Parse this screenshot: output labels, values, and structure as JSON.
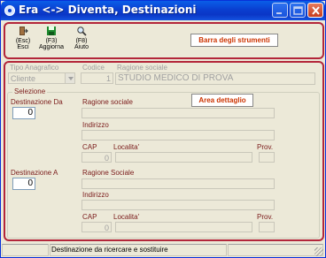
{
  "window": {
    "title": "Era <-> Diventa, Destinazioni",
    "buttons": {
      "minimize": "minimize-icon",
      "maximize": "maximize-icon",
      "close": "close-icon"
    }
  },
  "toolbar": {
    "items": [
      {
        "shortcut": "(Esc)",
        "label": "Esci",
        "icon": "exit-door-icon"
      },
      {
        "shortcut": "(F3)",
        "label": "Aggiorna",
        "icon": "save-disk-icon"
      },
      {
        "shortcut": "(F8)",
        "label": "Aiuto",
        "icon": "magnifier-help-icon"
      }
    ],
    "annotation": "Barra degli strumenti"
  },
  "header": {
    "tipo_anagrafico_label": "Tipo Anagrafico",
    "tipo_anagrafico_value": "Cliente",
    "codice_label": "Codice",
    "codice_value": "1",
    "ragione_sociale_label": "Ragione sociale",
    "ragione_sociale_value": "STUDIO MEDICO DI PROVA"
  },
  "selezione": {
    "caption": "Selezione",
    "annotation": "Area dettaglio",
    "da": {
      "label": "Destinazione Da",
      "value": "0",
      "ragione_label": "Ragione sociale",
      "indirizzo_label": "Indirizzo",
      "cap_label": "CAP",
      "cap_value": "0",
      "localita_label": "Localita'",
      "prov_label": "Prov."
    },
    "a": {
      "label": "Destinazione A",
      "value": "0",
      "ragione_label": "Ragione Sociale",
      "indirizzo_label": "Indirizzo",
      "cap_label": "CAP",
      "cap_value": "0",
      "localita_label": "Localita'",
      "prov_label": "Prov."
    }
  },
  "status": {
    "text": "Destinazione da ricercare e sostituire"
  },
  "colors": {
    "panel_border": "#b3263a",
    "annotation_text": "#cc3300",
    "label_text": "#7a1a1a"
  }
}
